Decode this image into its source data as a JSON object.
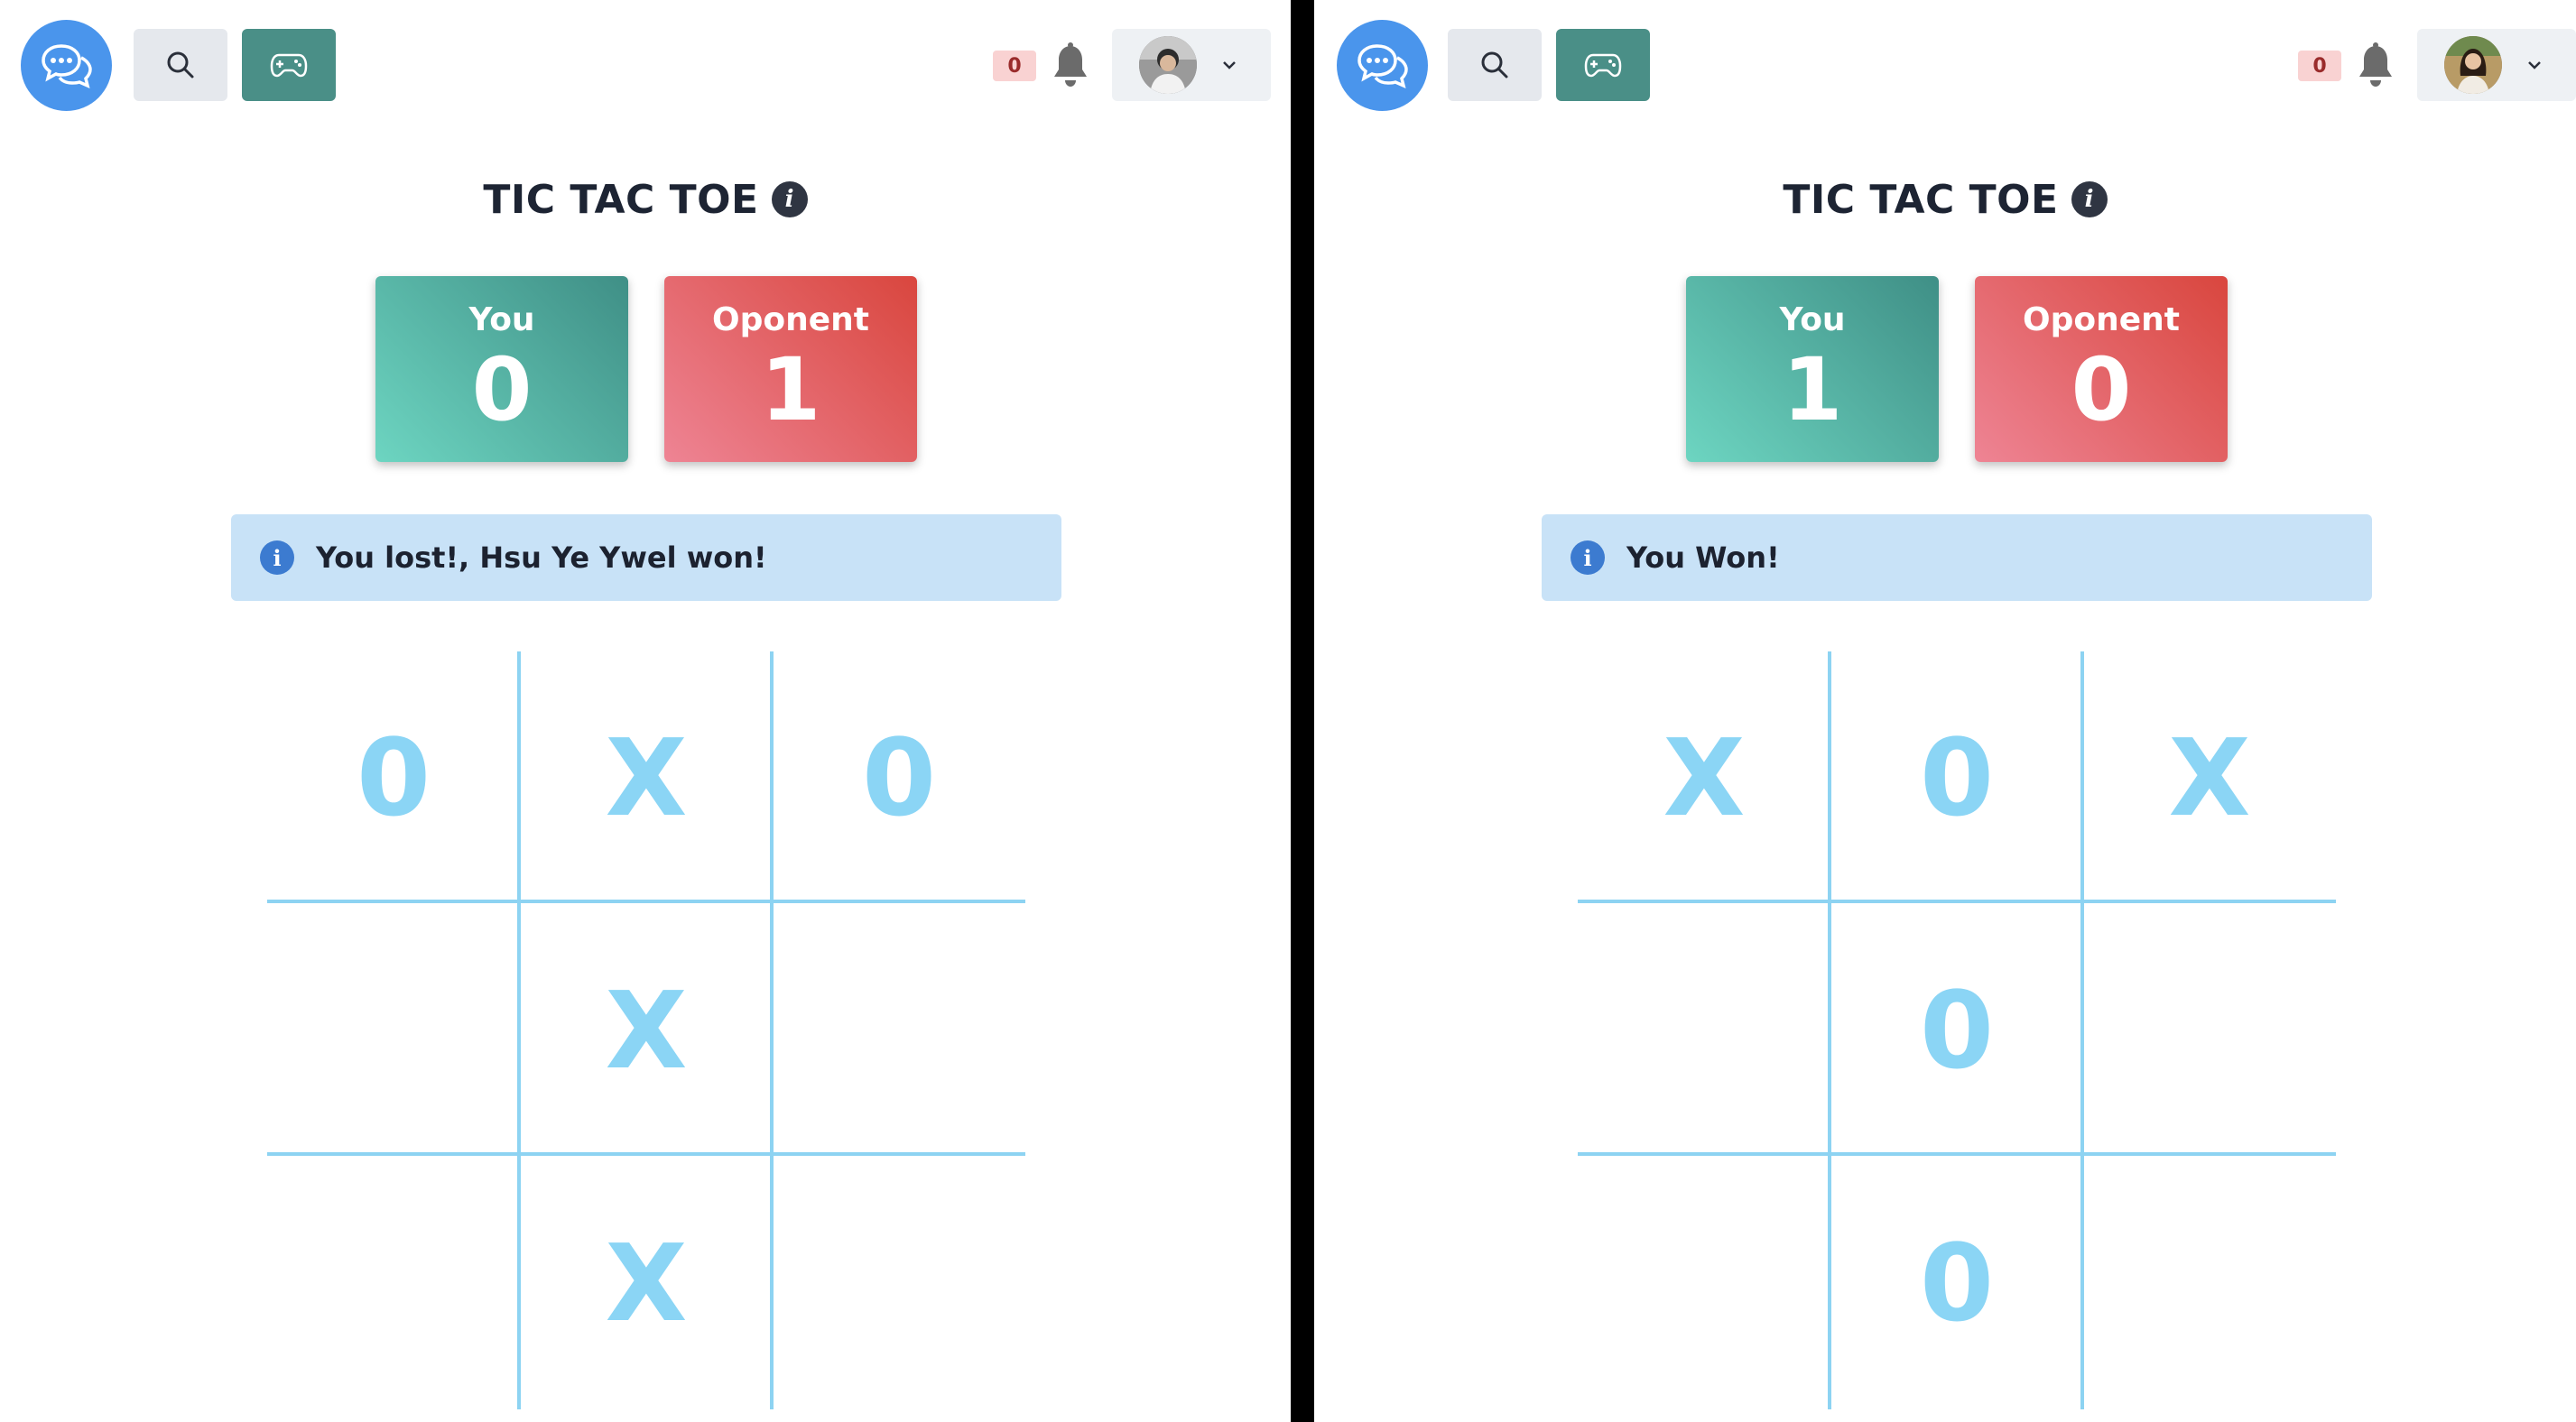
{
  "left": {
    "notifications": {
      "count": "0"
    },
    "title": "TIC TAC TOE",
    "scores": {
      "you": {
        "label": "You",
        "value": "0"
      },
      "opponent": {
        "label": "Oponent",
        "value": "1"
      }
    },
    "alert": {
      "text": "You lost!, Hsu Ye Ywel won!"
    },
    "board": [
      "0",
      "X",
      "0",
      "",
      "X",
      "",
      "",
      "X",
      ""
    ]
  },
  "right": {
    "notifications": {
      "count": "0"
    },
    "title": "TIC TAC TOE",
    "scores": {
      "you": {
        "label": "You",
        "value": "1"
      },
      "opponent": {
        "label": "Oponent",
        "value": "0"
      }
    },
    "alert": {
      "text": "You Won!"
    },
    "board": [
      "X",
      "0",
      "X",
      "",
      "0",
      "",
      "",
      "0",
      ""
    ]
  },
  "icons": {
    "logo": "chat-bubble-icon",
    "search": "search-icon",
    "game": "gamepad-icon",
    "bell": "bell-icon",
    "chevron": "chevron-down-icon",
    "info": "info-icon"
  },
  "colors": {
    "brand_blue": "#4a95ec",
    "teal": "#4a8f87",
    "you_card": "#4fae9f",
    "opponent_card": "#e0575a",
    "alert_bg": "#c8e2f7",
    "board_lines": "#8dd3f2",
    "board_marks": "#8bd5f5"
  }
}
